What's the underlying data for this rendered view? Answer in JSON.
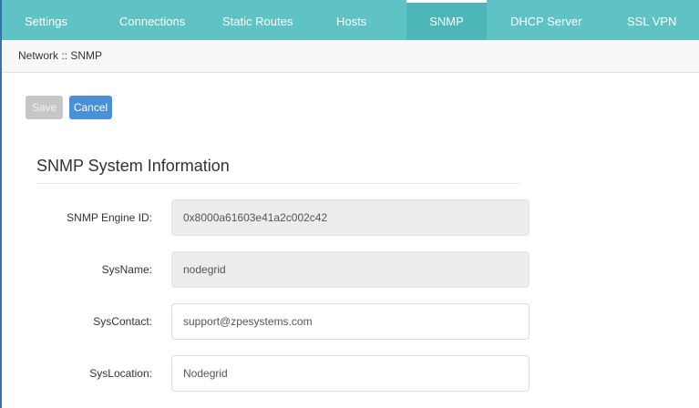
{
  "tabs": [
    {
      "label": "Settings",
      "active": false
    },
    {
      "label": "Connections",
      "active": false
    },
    {
      "label": "Static Routes",
      "active": false
    },
    {
      "label": "Hosts",
      "active": false
    },
    {
      "label": "SNMP",
      "active": true
    },
    {
      "label": "DHCP Server",
      "active": false
    },
    {
      "label": "SSL VPN",
      "active": false
    }
  ],
  "breadcrumb": "Network :: SNMP",
  "actions": {
    "save_label": "Save",
    "cancel_label": "Cancel"
  },
  "section": {
    "title": "SNMP System Information"
  },
  "fields": {
    "engine_id": {
      "label": "SNMP Engine ID:",
      "value": "0x8000a61603e41a2c002c42",
      "readonly": true
    },
    "sysname": {
      "label": "SysName:",
      "value": "nodegrid",
      "readonly": true
    },
    "syscontact": {
      "label": "SysContact:",
      "value": "support@zpesystems.com",
      "readonly": false
    },
    "syslocation": {
      "label": "SysLocation:",
      "value": "Nodegrid",
      "readonly": false
    }
  },
  "colors": {
    "tabbar": "#5fc3c5",
    "active_tab": "#4db6b8",
    "cancel_button": "#4a90d9",
    "save_button_disabled": "#c6c6c6"
  }
}
